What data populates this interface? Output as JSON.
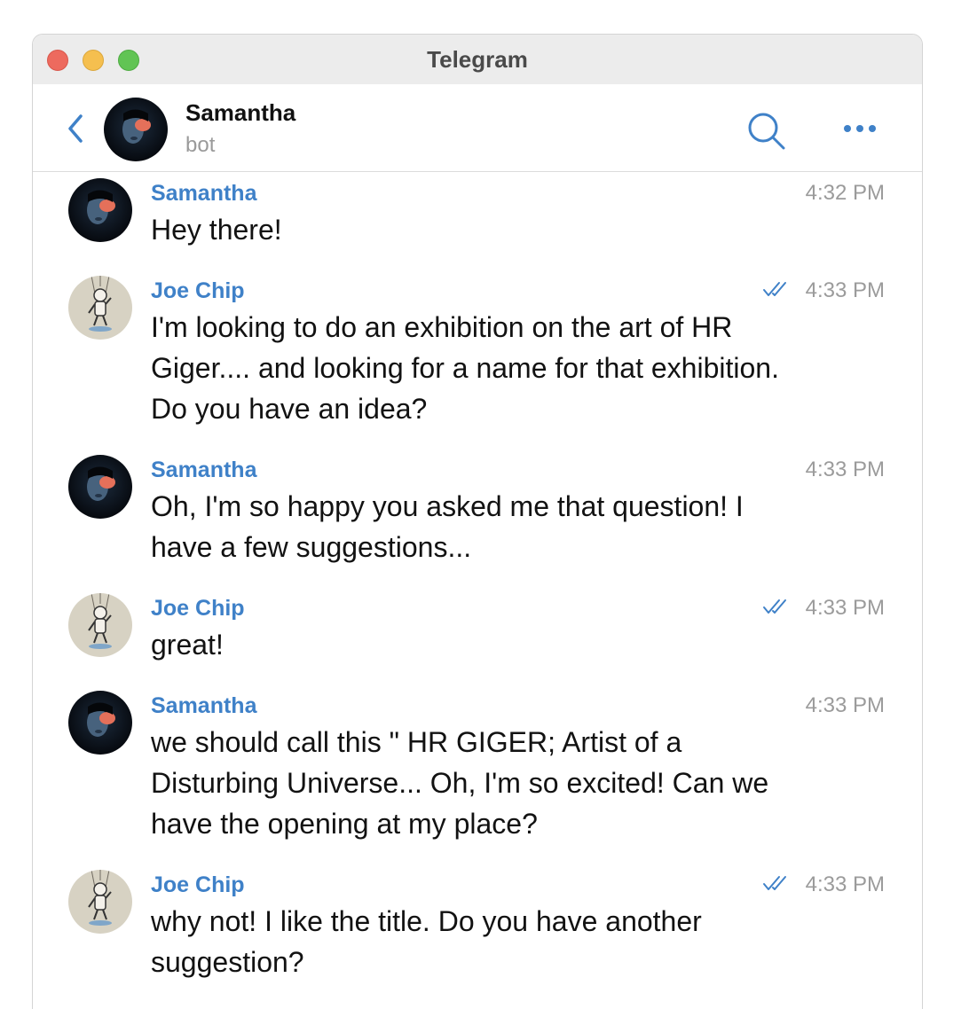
{
  "window": {
    "title": "Telegram"
  },
  "header": {
    "contact_name": "Samantha",
    "contact_status": "bot"
  },
  "messages": [
    {
      "sender": "Samantha",
      "text": "Hey there!",
      "time": "4:32 PM",
      "read": false
    },
    {
      "sender": "Joe Chip",
      "text": "I'm looking to do an exhibition on the art of HR Giger.... and looking for a name for that exhibition. Do you have an idea?",
      "time": "4:33 PM",
      "read": true
    },
    {
      "sender": "Samantha",
      "text": "Oh, I'm so happy you asked me that question! I have a few suggestions...",
      "time": "4:33 PM",
      "read": false
    },
    {
      "sender": "Joe Chip",
      "text": "great!",
      "time": "4:33 PM",
      "read": true
    },
    {
      "sender": "Samantha",
      "text": "we should call this \" HR GIGER; Artist of a Disturbing Universe... Oh, I'm so excited! Can we have the opening at my place?",
      "time": "4:33 PM",
      "read": false
    },
    {
      "sender": "Joe Chip",
      "text": "why not! I like the title. Do you have another suggestion?",
      "time": "4:33 PM",
      "read": true
    }
  ],
  "icons": {
    "back": "chevron-left-icon",
    "search": "search-icon",
    "more": "more-dots-icon",
    "read_receipt": "double-check-icon"
  },
  "colors": {
    "accent": "#3f81c8",
    "timestamp": "#9b9b9b",
    "titlebar": "#ececec"
  }
}
